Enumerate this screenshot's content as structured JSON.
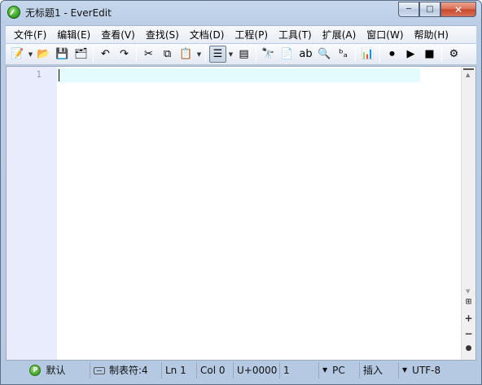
{
  "window": {
    "title": "无标题1 - EverEdit",
    "minimize_icon": "─",
    "maximize_icon": "□",
    "close_icon": "✕"
  },
  "menu": {
    "items": [
      {
        "label": "文件(F)"
      },
      {
        "label": "编辑(E)"
      },
      {
        "label": "查看(V)"
      },
      {
        "label": "查找(S)"
      },
      {
        "label": "文档(D)"
      },
      {
        "label": "工程(P)"
      },
      {
        "label": "工具(T)"
      },
      {
        "label": "扩展(A)"
      },
      {
        "label": "窗口(W)"
      },
      {
        "label": "帮助(H)"
      }
    ]
  },
  "toolbar": {
    "glyphs": {
      "new": "📝",
      "open": "📂",
      "save": "💾",
      "save_all": "🗂",
      "undo": "↶",
      "redo": "↷",
      "cut": "✂",
      "copy": "⧉",
      "paste": "📋",
      "word_wrap": "☰",
      "show_whitespace": "▤",
      "find": "🔭",
      "find_in_files": "📄",
      "replace": "ab",
      "find_next": "🔍",
      "replace_in_files": "ᵇₐ",
      "column_mode": "📊",
      "macro_record": "⏺",
      "macro_play": "▶",
      "macro_stop": "■",
      "extra": "⚙",
      "dropdown": "▼"
    }
  },
  "editor": {
    "line_numbers": [
      "1"
    ],
    "content": ""
  },
  "scrollbar": {
    "up": "▲",
    "down": "▼",
    "split": "⊞",
    "zoom_in": "+",
    "zoom_out": "−",
    "settings": "●"
  },
  "status": {
    "language_badge": "P",
    "language": "默认",
    "tab_setting": "制表符:4",
    "line": "Ln 1",
    "column": "Col 0",
    "unicode": "U+0000",
    "selection_count": "1",
    "line_ending": "PC",
    "insert_mode": "插入",
    "encoding": "UTF-8",
    "dropdown": "▼"
  }
}
